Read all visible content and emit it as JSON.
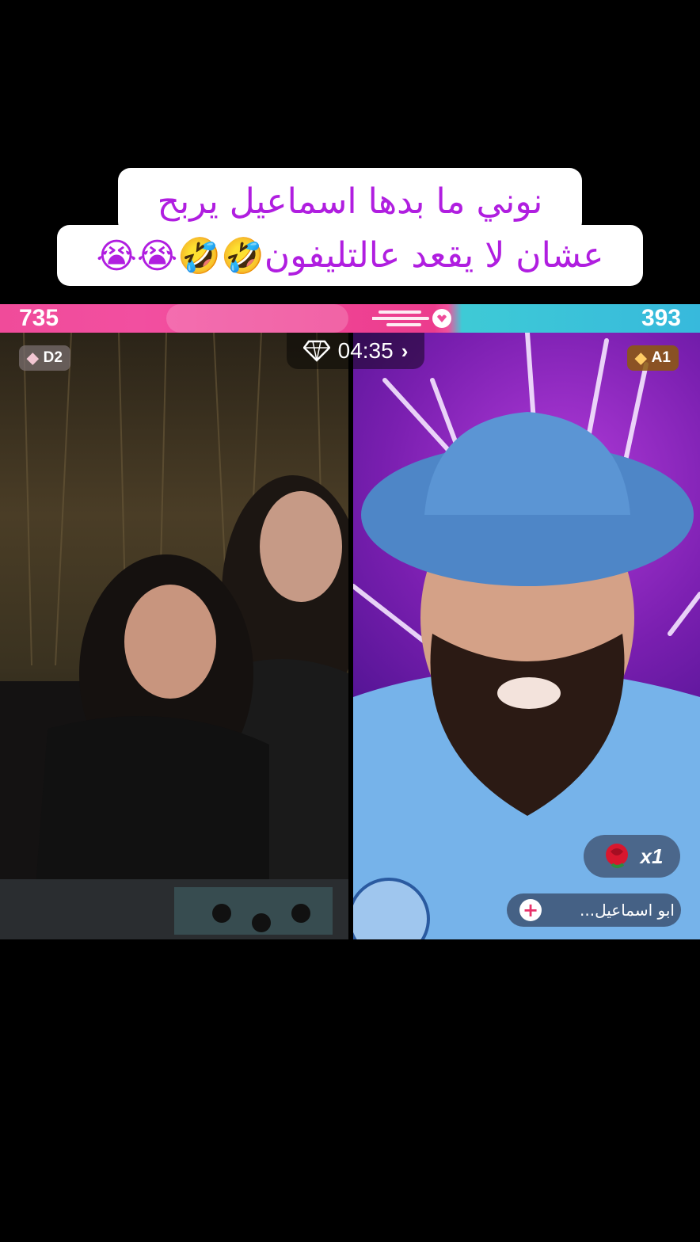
{
  "caption": {
    "line1": "نوني ما بدها اسماعيل يربح",
    "line2_text": "عشان لا يقعد عالتليفون",
    "line2_emoji": "🤣🤣😭😭"
  },
  "battle": {
    "left_score": "735",
    "right_score": "393",
    "left_rank": "D2",
    "right_rank": "A1",
    "timer": "04:35"
  },
  "gift": {
    "count": "x1",
    "icon": "rose-icon"
  },
  "host": {
    "name": "ابو اسماعيل...",
    "follow_symbol": "+"
  },
  "colors": {
    "caption_text": "#b01ee0",
    "left_bar": "#f04b9a",
    "right_bar": "#37b9dc"
  }
}
